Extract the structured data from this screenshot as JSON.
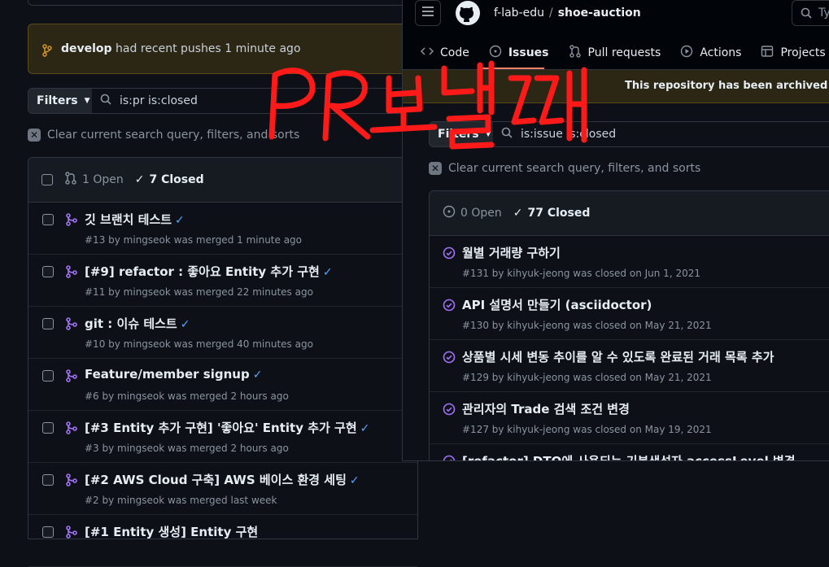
{
  "left": {
    "banner": {
      "branch": "develop",
      "text": "had recent pushes 1 minute ago"
    },
    "filters_label": "Filters",
    "search_value": "is:pr is:closed",
    "clear_text": "Clear current search query, filters, and sorts",
    "open_count": "1 Open",
    "closed_count": "7 Closed",
    "rows": [
      {
        "title": "깃 브랜치 테스트",
        "meta": "#13 by mingseok was merged 1 minute ago"
      },
      {
        "title": "[#9] refactor : 좋아요 Entity 추가 구현",
        "meta": "#11 by mingseok was merged 22 minutes ago"
      },
      {
        "title": "git : 이슈 테스트",
        "meta": "#10 by mingseok was merged 40 minutes ago"
      },
      {
        "title": "Feature/member signup",
        "meta": "#6 by mingseok was merged 2 hours ago"
      },
      {
        "title": "[#3 Entity 추가 구현] '좋아요' Entity 추가 구현",
        "meta": "#3 by mingseok was merged 2 hours ago"
      },
      {
        "title": "[#2 AWS Cloud 구축] AWS 베이스 환경 세팅",
        "meta": "#2 by mingseok was merged last week"
      },
      {
        "title": "[#1 Entity 생성] Entity 구현",
        "meta": ""
      }
    ]
  },
  "right": {
    "org": "f-lab-edu",
    "repo": "shoe-auction",
    "search_placeholder": "Ty",
    "tabs": [
      {
        "label": "Code",
        "icon": "code-icon"
      },
      {
        "label": "Issues",
        "icon": "issue-icon"
      },
      {
        "label": "Pull requests",
        "icon": "pull-request-icon"
      },
      {
        "label": "Actions",
        "icon": "play-icon"
      },
      {
        "label": "Projects",
        "icon": "table-icon"
      }
    ],
    "archived_text": "This repository has been archived by the",
    "filters_label": "Filters",
    "search_value": "is:issue is:closed",
    "clear_text": "Clear current search query, filters, and sorts",
    "open_count": "0 Open",
    "closed_count": "77 Closed",
    "rows": [
      {
        "title": "월별 거래량 구하기",
        "meta": "#131 by kihyuk-jeong was closed on Jun 1, 2021"
      },
      {
        "title": "API 설명서 만들기 (asciidoctor)",
        "meta": "#130 by kihyuk-jeong was closed on May 21, 2021"
      },
      {
        "title": "상품별 시세 변동 추이를 알 수 있도록 완료된 거래 목록 추가",
        "meta": "#129 by kihyuk-jeong was closed on May 21, 2021"
      },
      {
        "title": "관리자의 Trade 검색 조건 변경",
        "meta": "#127 by kihyuk-jeong was closed on May 19, 2021"
      },
      {
        "title": "[refactor] DTO에 사용되는 기본생성자 accessLevel 변경",
        "meta": ""
      }
    ]
  },
  "annotation": "PR 보낼때",
  "colors": {
    "accent": "#58a6ff",
    "merged": "#a371f7",
    "annotation": "#ff1a1a",
    "tab_underline": "#f78166"
  }
}
